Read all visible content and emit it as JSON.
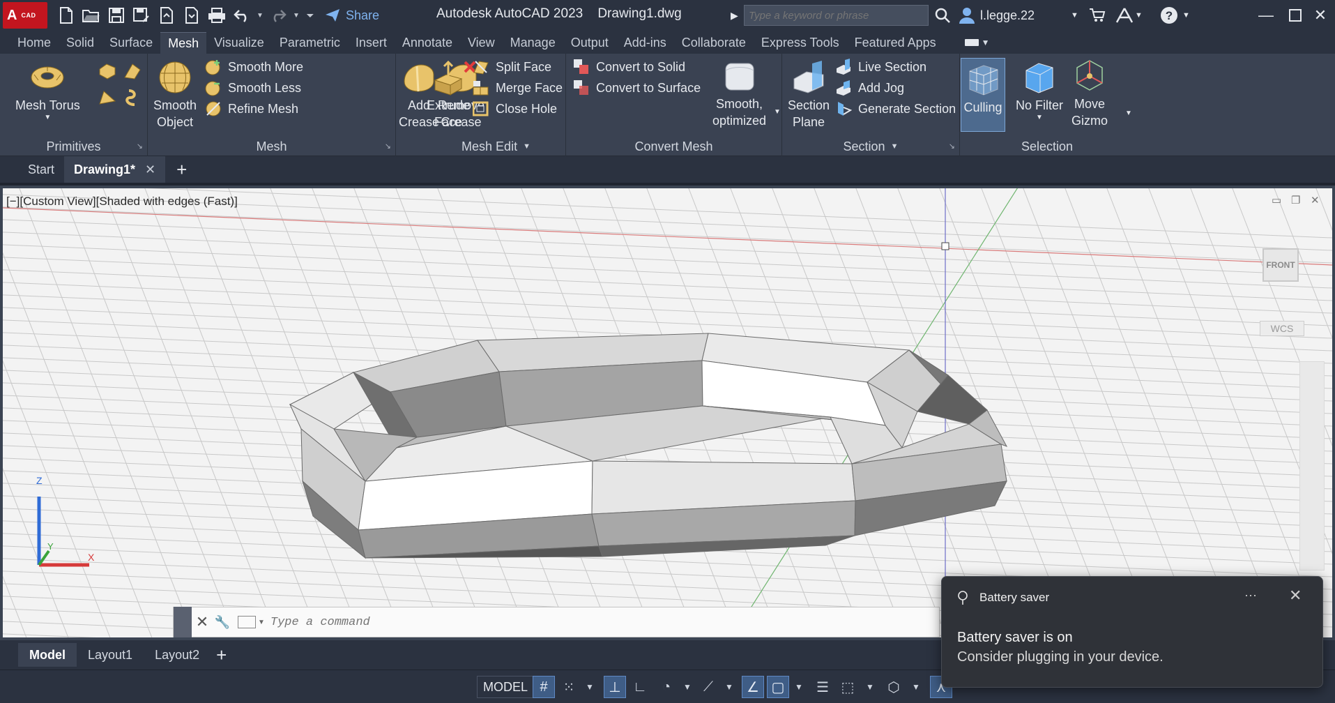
{
  "app": {
    "title": "Autodesk AutoCAD 2023",
    "document": "Drawing1.dwg",
    "logo_letter": "A",
    "logo_sub": "CAD",
    "share_label": "Share",
    "search_placeholder": "Type a keyword or phrase",
    "user": "l.legge.22"
  },
  "colors": {
    "accent": "#4d6a8e",
    "brand_red": "#c3151f",
    "ribbon_bg": "#3a4252",
    "titlebar_bg": "#2b3240"
  },
  "ribbon_tabs": [
    "Home",
    "Solid",
    "Surface",
    "Mesh",
    "Visualize",
    "Parametric",
    "Insert",
    "Annotate",
    "View",
    "Manage",
    "Output",
    "Add-ins",
    "Collaborate",
    "Express Tools",
    "Featured Apps"
  ],
  "active_tab": "Mesh",
  "panels": {
    "primitives": {
      "title": "Primitives",
      "mesh_torus": "Mesh Torus"
    },
    "mesh": {
      "title": "Mesh",
      "smooth_object_1": "Smooth",
      "smooth_object_2": "Object",
      "smooth_more": "Smooth More",
      "smooth_less": "Smooth Less",
      "refine_mesh": "Refine Mesh"
    },
    "mesh_edit": {
      "title": "Mesh Edit",
      "add_crease_1": "Add",
      "add_crease_2": "Crease",
      "remove_crease_1": "Remove",
      "remove_crease_2": "Crease",
      "extrude_face_1": "Extrude",
      "extrude_face_2": "Face",
      "split_face": "Split Face",
      "merge_face": "Merge Face",
      "close_hole": "Close Hole"
    },
    "convert_mesh": {
      "title": "Convert Mesh",
      "convert_solid": "Convert to Solid",
      "convert_surface": "Convert to Surface",
      "smooth_opt_1": "Smooth,",
      "smooth_opt_2": "optimized"
    },
    "section": {
      "title": "Section",
      "section_plane_1": "Section",
      "section_plane_2": "Plane",
      "live_section": "Live Section",
      "add_jog": "Add Jog",
      "generate_section": "Generate Section"
    },
    "selection": {
      "title": "Selection",
      "culling": "Culling",
      "no_filter": "No Filter",
      "move_gizmo_1": "Move",
      "move_gizmo_2": "Gizmo"
    }
  },
  "file_tabs": {
    "start": "Start",
    "drawing": "Drawing1*"
  },
  "viewport": {
    "label": "[−][Custom View][Shaded with edges (Fast)]",
    "viewcube": "FRONT",
    "wcs": "WCS"
  },
  "command_line": {
    "placeholder": "Type a command"
  },
  "layout_tabs": [
    "Model",
    "Layout1",
    "Layout2"
  ],
  "status": {
    "model": "MODEL"
  },
  "toast": {
    "app": "Battery saver",
    "title": "Battery saver is on",
    "body": "Consider plugging in your device.",
    "more": "···",
    "close": "✕"
  }
}
